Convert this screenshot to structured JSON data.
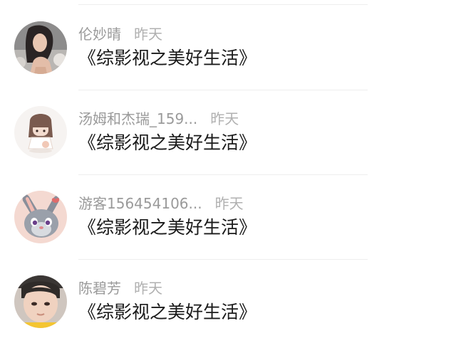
{
  "comments": [
    {
      "username": "伦妙晴",
      "time": "昨天",
      "text": "《综影视之美好生活》",
      "avatar": "avatar-woman-photo"
    },
    {
      "username": "汤姆和杰瑞_159...",
      "time": "昨天",
      "text": "《综影视之美好生活》",
      "avatar": "avatar-cartoon-girl"
    },
    {
      "username": "游客156454106...",
      "time": "昨天",
      "text": "《综影视之美好生活》",
      "avatar": "avatar-cartoon-rabbit"
    },
    {
      "username": "陈碧芳",
      "time": "昨天",
      "text": "《综影视之美好生活》",
      "avatar": "avatar-child-photo"
    }
  ]
}
